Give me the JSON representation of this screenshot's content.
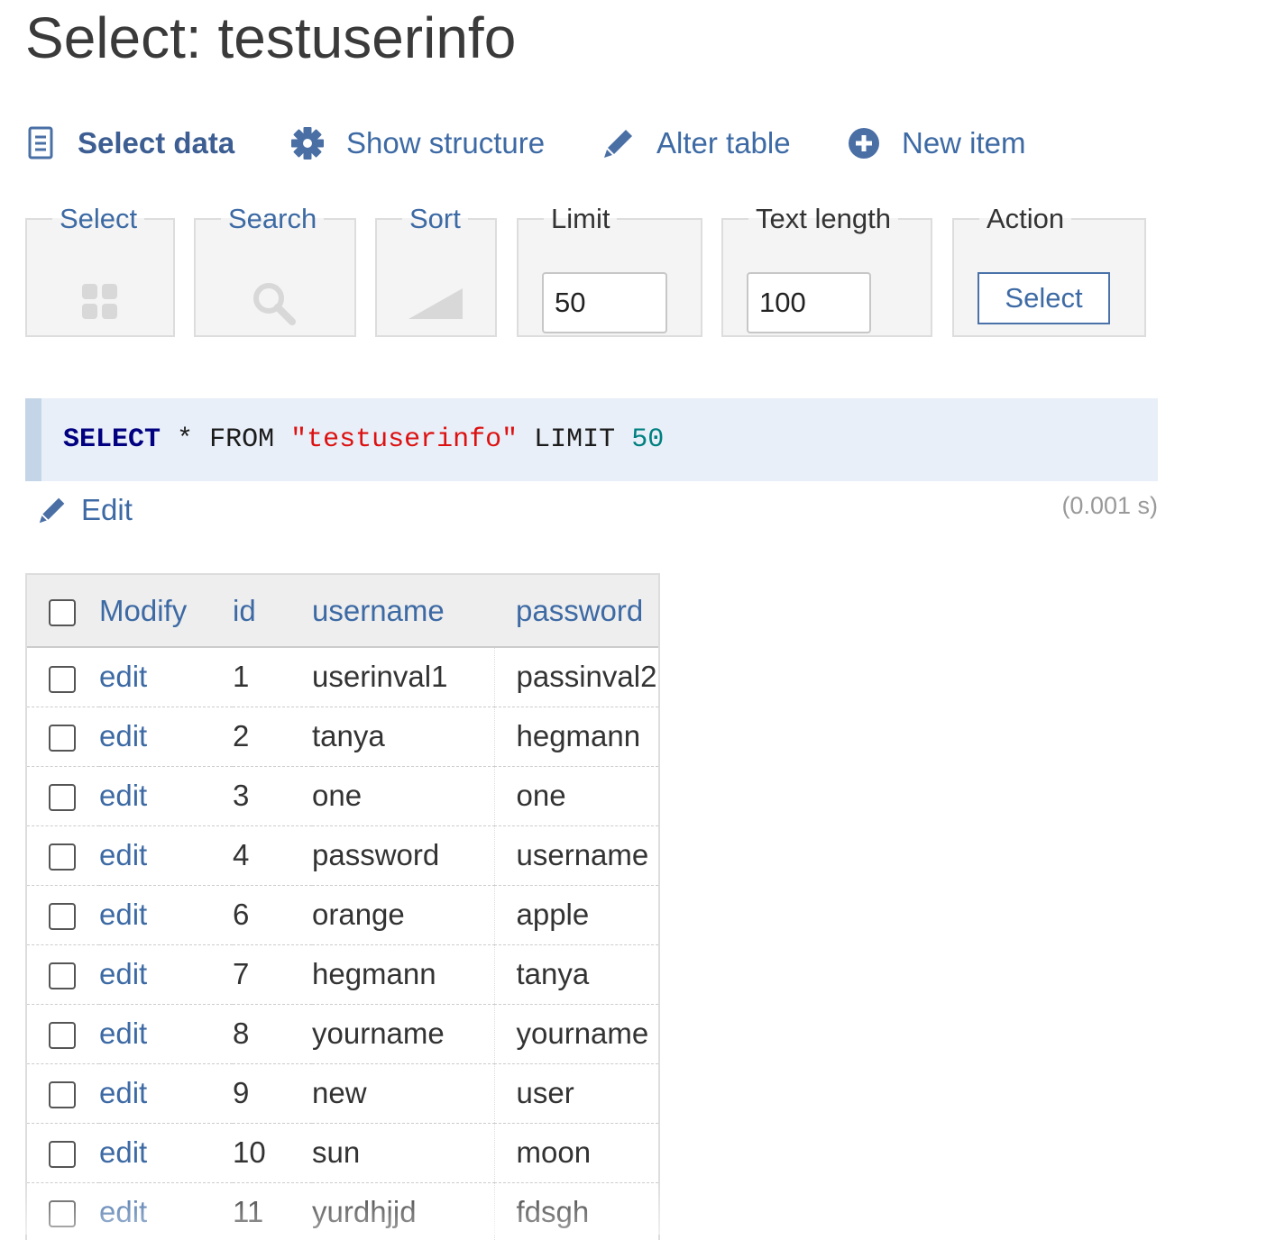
{
  "page": {
    "title": "Select: testuserinfo"
  },
  "nav": {
    "select_data": "Select data",
    "show_structure": "Show structure",
    "alter_table": "Alter table",
    "new_item": "New item"
  },
  "form": {
    "select_legend": "Select",
    "search_legend": "Search",
    "sort_legend": "Sort",
    "limit_legend": "Limit",
    "limit_value": "50",
    "text_length_legend": "Text length",
    "text_length_value": "100",
    "action_legend": "Action",
    "action_button": "Select"
  },
  "query": {
    "kw_select": "SELECT",
    "star": "*",
    "kw_from": "FROM",
    "table_literal": "\"testuserinfo\"",
    "kw_limit": "LIMIT",
    "limit_num": "50",
    "edit_label": "Edit",
    "timing": "(0.001 s)"
  },
  "table": {
    "headers": {
      "modify": "Modify",
      "id": "id",
      "username": "username",
      "password": "password"
    },
    "rows": [
      {
        "action": "edit",
        "id": "1",
        "username": "userinval1",
        "password": "passinval2"
      },
      {
        "action": "edit",
        "id": "2",
        "username": "tanya",
        "password": "hegmann"
      },
      {
        "action": "edit",
        "id": "3",
        "username": "one",
        "password": "one"
      },
      {
        "action": "edit",
        "id": "4",
        "username": "password",
        "password": "username"
      },
      {
        "action": "edit",
        "id": "6",
        "username": "orange",
        "password": "apple"
      },
      {
        "action": "edit",
        "id": "7",
        "username": "hegmann",
        "password": "tanya"
      },
      {
        "action": "edit",
        "id": "8",
        "username": "yourname",
        "password": "yourname"
      },
      {
        "action": "edit",
        "id": "9",
        "username": "new",
        "password": "user"
      },
      {
        "action": "edit",
        "id": "10",
        "username": "sun",
        "password": "moon"
      },
      {
        "action": "edit",
        "id": "11",
        "username": "yurdhjjd",
        "password": "fdsgh"
      }
    ]
  }
}
